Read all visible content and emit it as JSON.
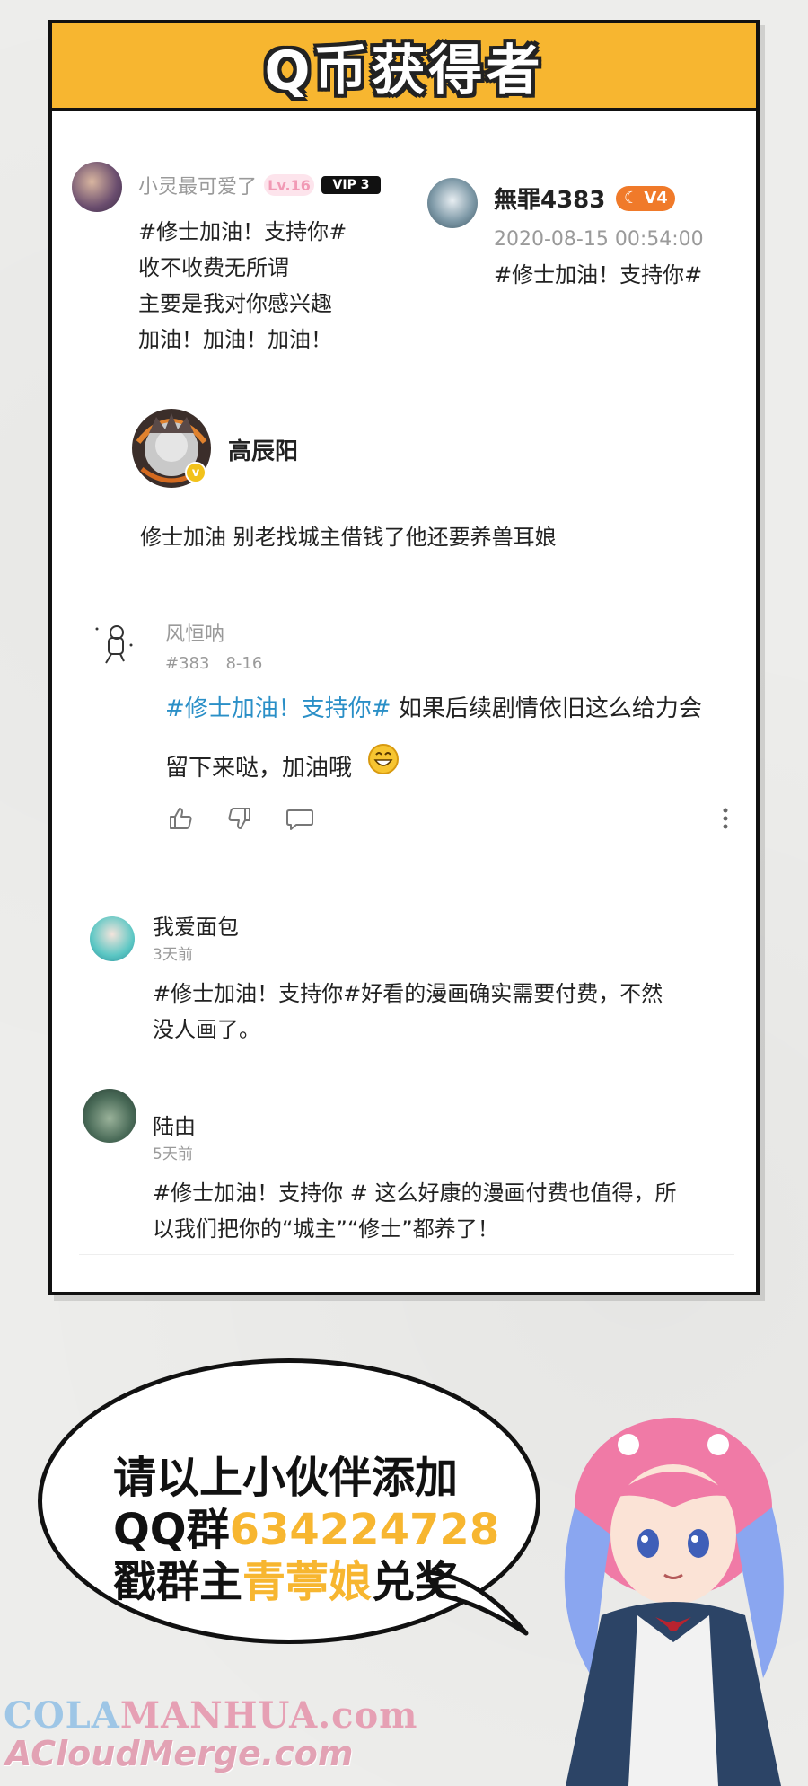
{
  "header": {
    "title": "Q币获得者"
  },
  "comments": [
    {
      "user": "小灵最可爱了",
      "level": "Lv.16",
      "vip": "VIP",
      "vip_level": "3",
      "lines": [
        "#修士加油！支持你#",
        "收不收费无所谓",
        "主要是我对你感兴趣",
        "加油！加油！加油！"
      ]
    },
    {
      "user": "無罪4383",
      "badge": "V4",
      "time": "2020-08-15 00:54:00",
      "text": "#修士加油！支持你#"
    },
    {
      "user": "高辰阳",
      "avatar_badge": "v",
      "text": "修士加油 别老找城主借钱了他还要养兽耳娘"
    },
    {
      "user": "风恒呐",
      "number": "#383",
      "date": "8-16",
      "hashtag": "#修士加油！支持你#",
      "text_line1": " 如果后续剧情依旧这么给力会",
      "text_line2": "留下来哒，加油哦",
      "emoji": "😁"
    },
    {
      "user": "我爱面包",
      "time": "3天前",
      "lines": [
        "#修士加油！支持你#好看的漫画确实需要付费，不然",
        "没人画了。"
      ]
    },
    {
      "user": "陆由",
      "time": "5天前",
      "lines": [
        "#修士加油！支持你 # 这么好康的漫画付费也值得，所",
        "以我们把你的“城主”“修士”都养了！"
      ]
    }
  ],
  "bubble": {
    "line1": "请以上小伙伴添加",
    "line2_prefix": "QQ群",
    "line2_number": "634224728",
    "line3_prefix": "戳群主",
    "line3_name": "青葶娘",
    "line3_suffix": "兑奖"
  },
  "watermark": {
    "part1": "COLA",
    "part2": "MANHUA",
    "part3": ".com",
    "line2": "ACloudMerge.com"
  },
  "icons": [
    "like-icon",
    "dislike-icon",
    "reply-icon",
    "more-icon"
  ],
  "colors": {
    "accent": "#f7b630",
    "hashtag": "#2a8fc7",
    "level": "#f19ab5",
    "badge_orange": "#f07a2a"
  }
}
